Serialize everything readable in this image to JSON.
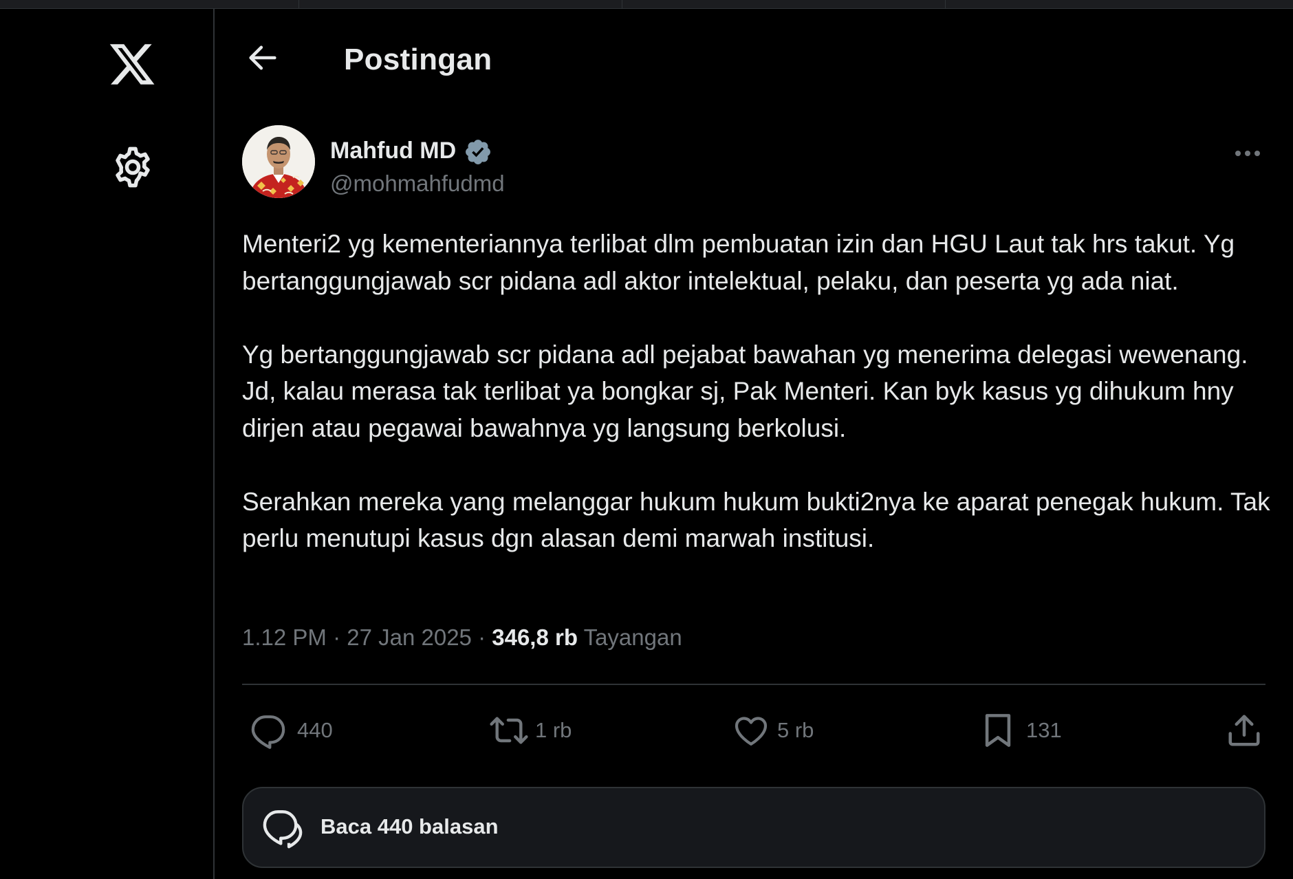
{
  "header": {
    "title": "Postingan"
  },
  "tweet": {
    "author": {
      "name": "Mahfud MD",
      "handle": "@mohmahfudmd",
      "verified": true
    },
    "paragraphs": [
      "Menteri2 yg kementeriannya terlibat dlm pembuatan izin dan HGU Laut tak hrs takut. Yg bertanggungjawab scr pidana adl aktor intelektual, pelaku, dan peserta yg ada niat.",
      "Yg bertanggungjawab scr pidana adl pejabat bawahan yg menerima delegasi wewenang. Jd, kalau merasa tak terlibat ya bongkar sj, Pak Menteri. Kan byk kasus yg dihukum hny dirjen atau pegawai bawahnya yg langsung berkolusi.",
      "Serahkan mereka yang melanggar hukum hukum bukti2nya ke aparat penegak hukum. Tak perlu menutupi kasus dgn alasan demi marwah institusi."
    ],
    "time": "1.12 PM",
    "date": "27 Jan 2025",
    "separator": " · ",
    "views": "346,8 rb",
    "views_label": "Tayangan"
  },
  "actions": {
    "replies": "440",
    "reposts": "1 rb",
    "likes": "5 rb",
    "bookmarks": "131"
  },
  "read_replies": {
    "label": "Baca 440 balasan"
  },
  "icons": {
    "logo": "x-logo-icon",
    "settings": "gear-icon",
    "back": "arrow-left-icon",
    "verified": "verified-badge-icon",
    "more": "more-horizontal-icon",
    "reply": "reply-bubble-icon",
    "repost": "repost-icon",
    "like": "heart-icon",
    "bookmark": "bookmark-icon",
    "share": "share-upload-icon",
    "read_replies": "chat-bubbles-icon"
  },
  "colors": {
    "background": "#000000",
    "text_primary": "#e7e9ea",
    "text_secondary": "#71767b",
    "border": "#2f3336",
    "verified_badge": "#829aab",
    "card_background": "#16181c"
  }
}
